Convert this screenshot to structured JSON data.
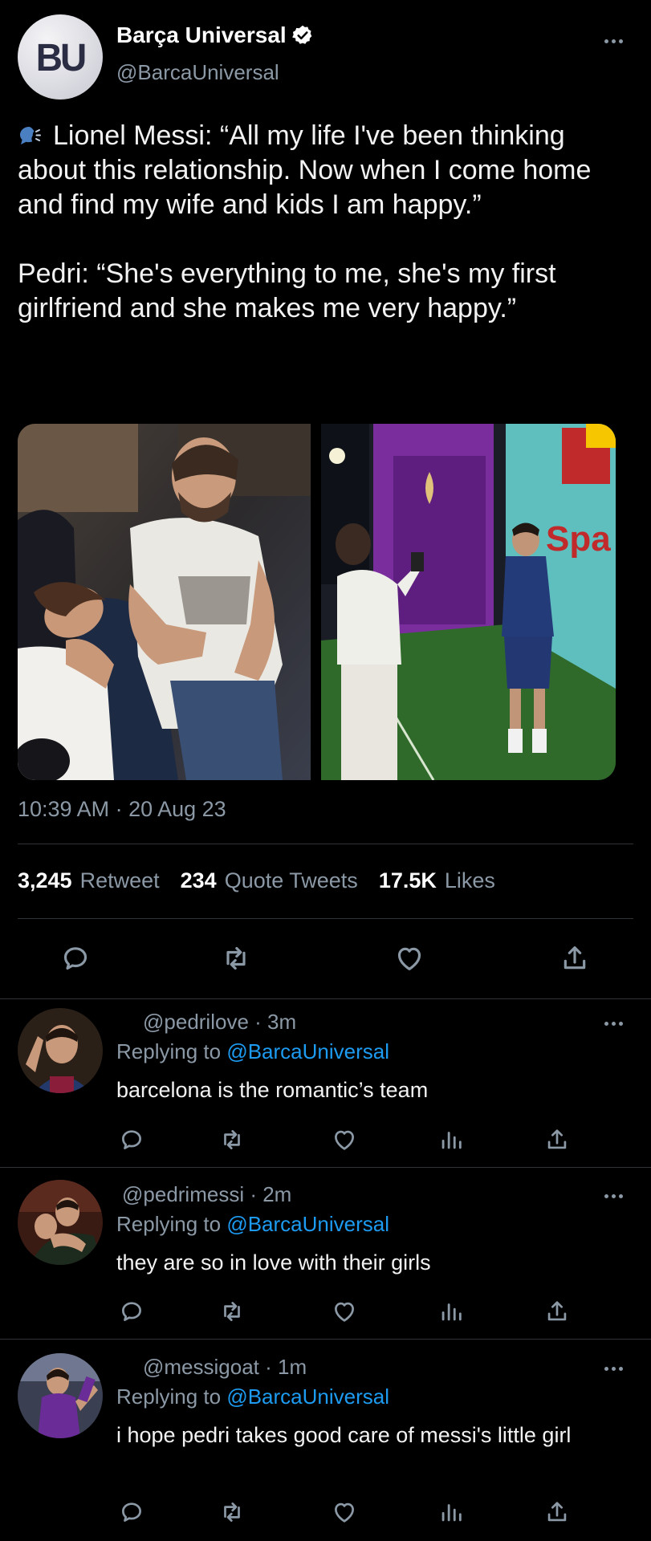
{
  "tweet": {
    "author_name": "Barça Universal",
    "author_handle": "@BarcaUniversal",
    "avatar_text": "BU",
    "text": "Lionel Messi: “All my life I've been thinking about this relationship. Now when I come home and find my wife and kids I am happy.”\n\nPedri: “She's everything to me, she's my first girlfriend and she makes me very happy.”",
    "timestamp": "10:39 AM · 20 Aug 23",
    "stats": {
      "retweets_count": "3,245",
      "retweets_label": "Retweet",
      "quotes_count": "234",
      "quotes_label": "Quote Tweets",
      "likes_count": "17.5K",
      "likes_label": "Likes"
    },
    "photos": [
      {
        "name": "photo-messi-couple"
      },
      {
        "name": "photo-pedri-girlfriend",
        "sign_text": "Spa"
      }
    ]
  },
  "replies": [
    {
      "handle_time": "@pedrilove · 3m",
      "replying_prefix": "Replying to ",
      "replying_handle": "@BarcaUniversal",
      "text": "barcelona is the romantic’s team"
    },
    {
      "handle_time": "@pedrimessi · 2m",
      "replying_prefix": "Replying to ",
      "replying_handle": "@BarcaUniversal",
      "text": "they are so in love with their girls"
    },
    {
      "handle_time": "@messigoat · 1m",
      "replying_prefix": "Replying to ",
      "replying_handle": "@BarcaUniversal",
      "text": "i hope pedri takes good care of messi's little girl"
    }
  ],
  "colors": {
    "background": "#000000",
    "secondary_text": "#8b98a5",
    "link": "#1d9bf0",
    "divider": "#2f3336"
  },
  "icons": [
    "verified-badge-icon",
    "more-icon",
    "speaker-icon",
    "reply-icon",
    "retweet-icon",
    "like-icon",
    "share-icon",
    "analytics-icon"
  ]
}
